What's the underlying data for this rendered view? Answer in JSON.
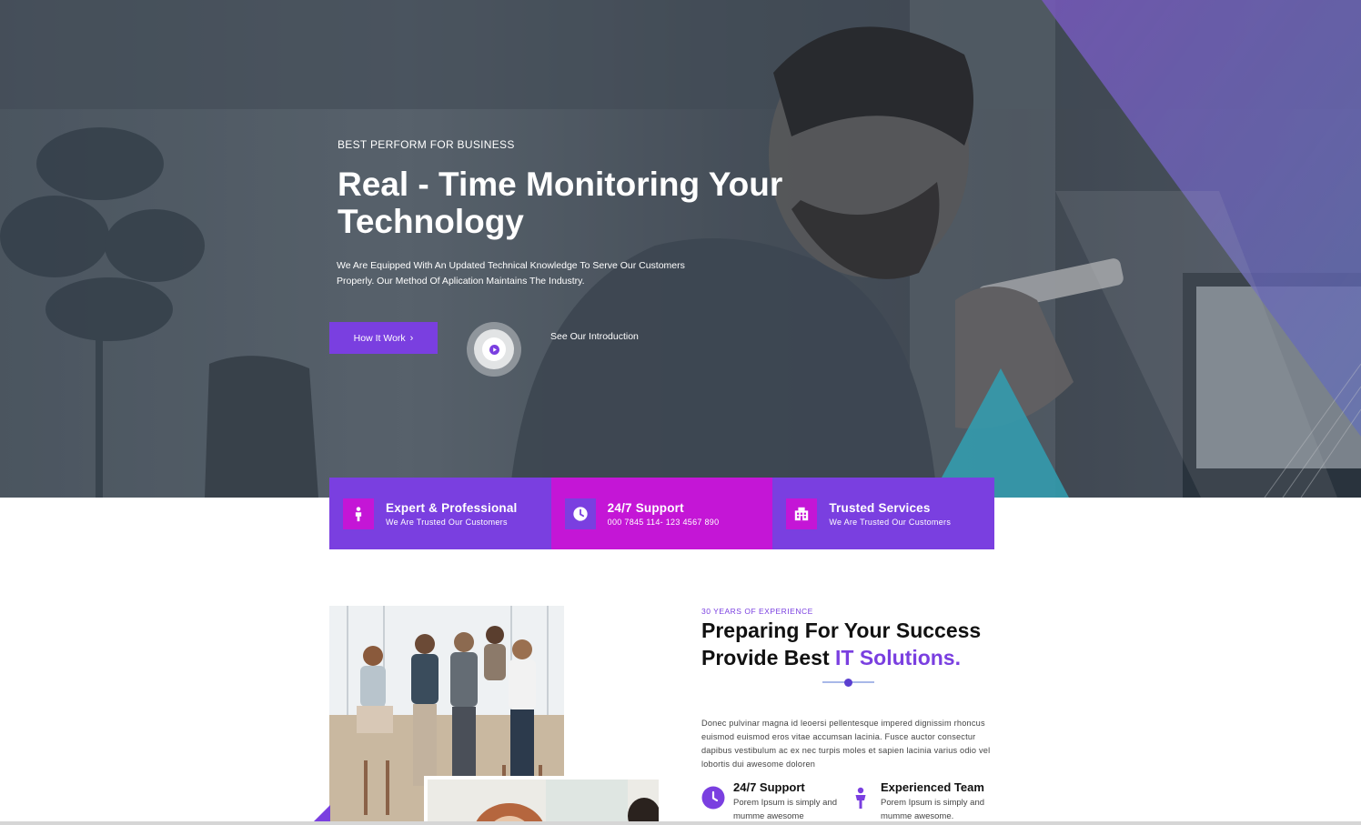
{
  "hero": {
    "tagline": "BEST PERFORM FOR BUSINESS",
    "headline": "Real - Time Monitoring Your Technology",
    "subtext": "We Are Equipped With An Updated Technical Knowledge To Serve Our Customers Properly. Our Method Of Aplication Maintains The Industry.",
    "primary_button": "How It Work",
    "intro_link": "See Our Introduction"
  },
  "features": [
    {
      "title": "Expert & Professional",
      "desc": "We Are Trusted Our Customers",
      "icon": "person-icon",
      "bg": "#7a3fe0"
    },
    {
      "title": "24/7 Support",
      "desc": "000 7845 114- 123 4567 890",
      "icon": "clock-icon",
      "bg": "#c416d6"
    },
    {
      "title": "Trusted Services",
      "desc": "We Are Trusted Our Customers",
      "icon": "building-icon",
      "bg": "#7a3fe0"
    }
  ],
  "about": {
    "tag": "30 YEARS OF EXPERIENCE",
    "title_line1": "Preparing For Your Success",
    "title_line2_prefix": "Provide Best ",
    "title_line2_highlight": "IT Solutions.",
    "body": "Donec pulvinar magna id leoersi pellentesque impered dignissim rhoncus euismod euismod eros vitae accumsan lacinia. Fusce auctor consectur dapibus vestibulum ac ex nec turpis moles et sapien lacinia varius odio vel lobortis dui awesome doloren",
    "points": [
      {
        "title": "24/7 Support",
        "desc": "Porem Ipsum is simply and mumme awesome",
        "icon": "clock-icon"
      },
      {
        "title": "Experienced Team",
        "desc": "Porem Ipsum is simply and mumme awesome.",
        "icon": "person-icon"
      }
    ]
  },
  "colors": {
    "accent": "#7a3fe0",
    "magenta": "#c416d6",
    "cyan": "#3cc8dc"
  }
}
